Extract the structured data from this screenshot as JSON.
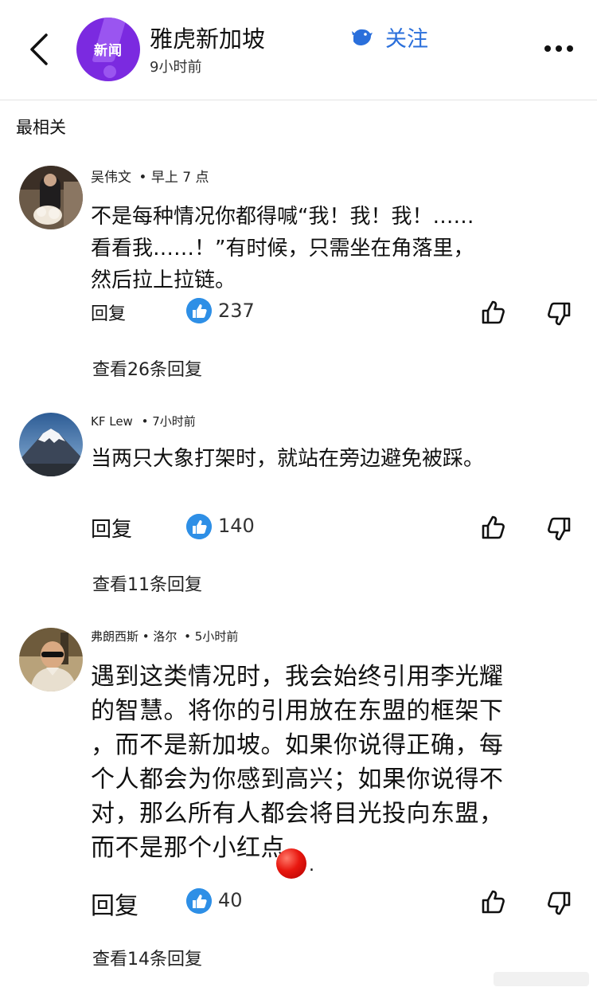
{
  "header": {
    "channel_avatar_text": "新闻",
    "channel_name": "雅虎新加坡",
    "post_time": "9小时前",
    "follow_label": "关注"
  },
  "section_title": "最相关",
  "comments": [
    {
      "author": "吴伟文",
      "time": "• 早上 7 点",
      "text_lines": [
        "不是每种情况你都得喊“我！我！我！……",
        "看看我……！”有时候，只需坐在角落里，",
        "然后拉上拉链。"
      ],
      "reply_label": "回复",
      "likes": "237",
      "view_replies": "查看26条回复"
    },
    {
      "author": "KF Lew",
      "time": "• 7小时前",
      "text_lines": [
        "当两只大象打架时，就站在旁边避免被踩。"
      ],
      "reply_label": "回复",
      "likes": "140",
      "view_replies": "查看11条回复"
    },
    {
      "author": "弗朗西斯 • 洛尔",
      "time": "• 5小时前",
      "text_lines": [
        "遇到这类情况时，我会始终引用李光耀",
        "的智慧。将你的引用放在东盟的框架下",
        "，而不是新加坡。如果你说得正确，每",
        "个人都会为你感到高兴；如果你说得不",
        "对，那么所有人都会将目光投向东盟，",
        "而不是那个小红点"
      ],
      "trailing_period": ".",
      "reply_label": "回复",
      "likes": "40",
      "view_replies": "查看14条回复"
    }
  ],
  "colors": {
    "accent_blue": "#2a6fdb",
    "like_badge": "#2e8fe6",
    "channel_purple": "#7b2ae0",
    "red_dot": "#e8170f"
  },
  "icons": {
    "back": "chevron-left-icon",
    "follow": "follow-bird-icon",
    "more": "more-dots-icon",
    "like_badge": "thumbs-up-badge-icon",
    "thumb_up": "thumb-up-outline-icon",
    "thumb_down": "thumb-down-outline-icon"
  }
}
